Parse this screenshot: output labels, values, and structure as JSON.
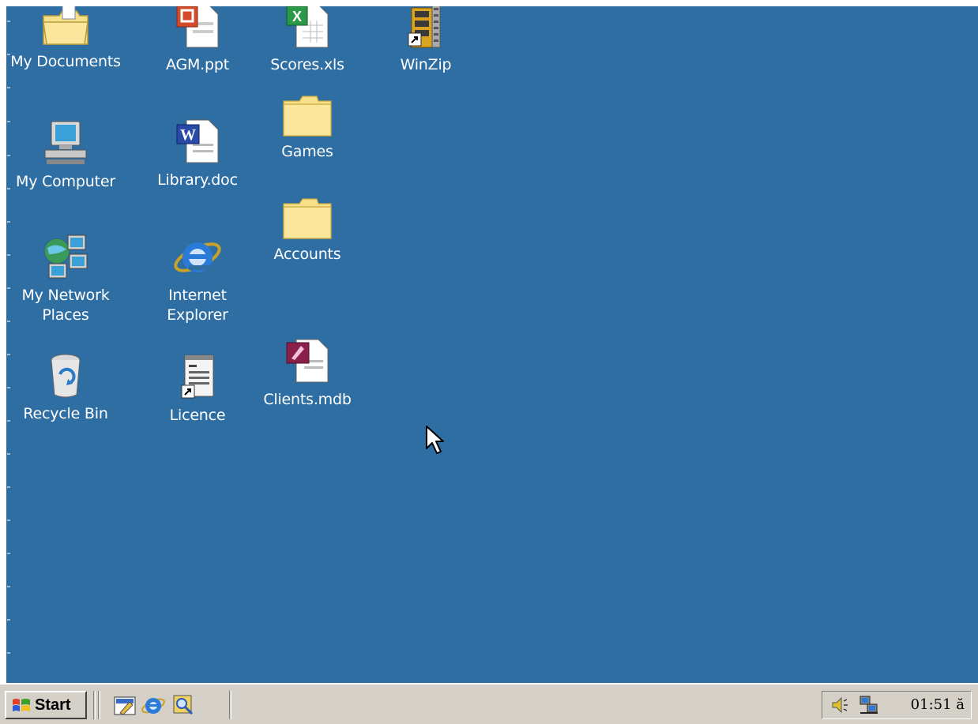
{
  "desktop": {
    "background_color": "#2f6ea3",
    "icons": {
      "my_documents": "My Documents",
      "agm_ppt": "AGM.ppt",
      "scores_xls": "Scores.xls",
      "winzip": "WinZip",
      "my_computer": "My Computer",
      "library_doc": "Library.doc",
      "games": "Games",
      "my_network_places": "My Network\nPlaces",
      "internet_explorer": "Internet\nExplorer",
      "accounts": "Accounts",
      "recycle_bin": "Recycle Bin",
      "licence": "Licence",
      "clients_mdb": "Clients.mdb"
    }
  },
  "taskbar": {
    "start_label": "Start",
    "quick_launch": [
      "show-desktop-icon",
      "internet-explorer-icon",
      "outlook-express-icon"
    ],
    "tray": {
      "icons": [
        "volume-icon",
        "network-icon"
      ],
      "clock": "01:51 ă"
    }
  }
}
